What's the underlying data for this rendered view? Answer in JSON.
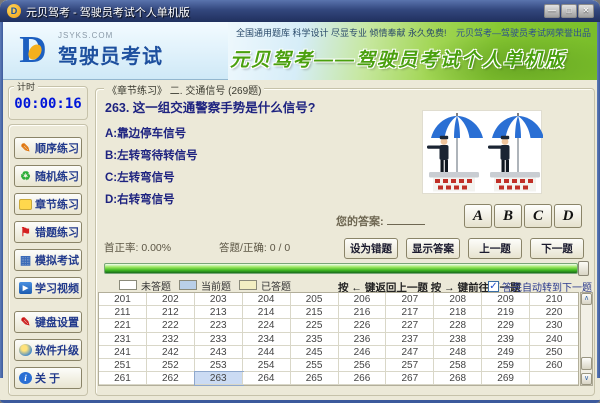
{
  "window": {
    "title": "元贝驾考 - 驾驶员考试个人单机版",
    "icon_letter": "D",
    "controls": [
      {
        "name": "minimize-button",
        "glyph": "—"
      },
      {
        "name": "maximize-button",
        "glyph": "□"
      },
      {
        "name": "close-button",
        "glyph": "✕"
      }
    ]
  },
  "header": {
    "logo": {
      "letter": "D",
      "site": "JSYKS.COM",
      "name": "驾驶员考试"
    },
    "banner": {
      "tagline": "全国通用题库 科学设计 尽显专业 倾情奉献 永久免费!",
      "publisher": "元贝驾考—驾驶员考试网荣誉出品",
      "headline": "元贝驾考——驾驶员考试个人单机版"
    }
  },
  "sidebar": {
    "timer": {
      "label": "计时",
      "value": "00:00:16"
    },
    "nav": [
      {
        "name": "sequential-practice",
        "label": "顺序练习",
        "icon": "pencil-icon",
        "glyph": "✎",
        "color": "#e0760f"
      },
      {
        "name": "random-practice",
        "label": "随机练习",
        "icon": "shuffle-icon",
        "glyph": "♻",
        "color": "#2fae3a"
      },
      {
        "name": "chapter-practice",
        "label": "章节练习",
        "icon": "note-icon",
        "glyph": "",
        "color": "#ffd84d"
      },
      {
        "name": "wrong-questions",
        "label": "错题练习",
        "icon": "flag-icon",
        "glyph": "⚑",
        "color": "#d42020"
      },
      {
        "name": "mock-exam",
        "label": "模拟考试",
        "icon": "exam-grid-icon",
        "glyph": "▦",
        "color": "#3a6ab8"
      },
      {
        "name": "study-video",
        "label": "学习视频",
        "icon": "video-play-icon",
        "glyph": "▶",
        "color": "#ffffff"
      }
    ],
    "tools": [
      {
        "name": "keyboard-settings",
        "label": "键盘设置",
        "icon": "pen-icon",
        "glyph": "✎",
        "color": "#cc1818"
      },
      {
        "name": "software-upgrade",
        "label": "软件升级",
        "icon": "globe-icon",
        "glyph": "",
        "color": "#3a86d0"
      },
      {
        "name": "about",
        "label": "关  于",
        "icon": "info-icon",
        "glyph": "i",
        "color": "#ffffff"
      }
    ]
  },
  "main": {
    "section_title": "《章节练习》 二. 交通信号 (269题)",
    "question": {
      "text": "263. 这一组交通警察手势是什么信号?",
      "options": [
        "A:靠边停车信号",
        "B:左转弯待转信号",
        "C:左转弯信号",
        "D:右转弯信号"
      ],
      "image_alt": "两名交通警察手势示意图"
    },
    "answer": {
      "label": "您的答案:",
      "value": "",
      "choices": [
        "A",
        "B",
        "C",
        "D"
      ]
    },
    "stats": {
      "first_rate": "首正率: 0.00%",
      "ratio": "答题/正确: 0 / 0"
    },
    "actions": [
      {
        "name": "mark-wrong-button",
        "label": "设为错题"
      },
      {
        "name": "show-answer-button",
        "label": "显示答案"
      },
      {
        "name": "prev-question-button",
        "label": "上一题"
      },
      {
        "name": "next-question-button",
        "label": "下一题"
      }
    ],
    "legend": [
      {
        "label": "未答题",
        "color": "#ffffff"
      },
      {
        "label": "当前题",
        "color": "#b9cfe8"
      },
      {
        "label": "已答题",
        "color": "#f2eec2"
      }
    ],
    "key_hints": "按 ← 键返回上一题   按 → 键前往下一题",
    "auto_next": {
      "label": "答完自动转到下一题",
      "checked": true,
      "check_glyph": "✓"
    },
    "grid": {
      "current": 263,
      "numbers": [
        201,
        202,
        203,
        204,
        205,
        206,
        207,
        208,
        209,
        210,
        211,
        212,
        213,
        214,
        215,
        216,
        217,
        218,
        219,
        220,
        221,
        222,
        223,
        224,
        225,
        226,
        227,
        228,
        229,
        230,
        231,
        232,
        233,
        234,
        235,
        236,
        237,
        238,
        239,
        240,
        241,
        242,
        243,
        244,
        245,
        246,
        247,
        248,
        249,
        250,
        251,
        252,
        253,
        254,
        255,
        256,
        257,
        258,
        259,
        260,
        261,
        262,
        263,
        264,
        265,
        266,
        267,
        268,
        269
      ]
    }
  },
  "colors": {
    "progress_green": "#3db520",
    "current_cell": "#cbdbf3",
    "current_cell_border": "#8fa8cc",
    "timer_blue": "#0016d9",
    "headline_green": "#4aa00e"
  }
}
